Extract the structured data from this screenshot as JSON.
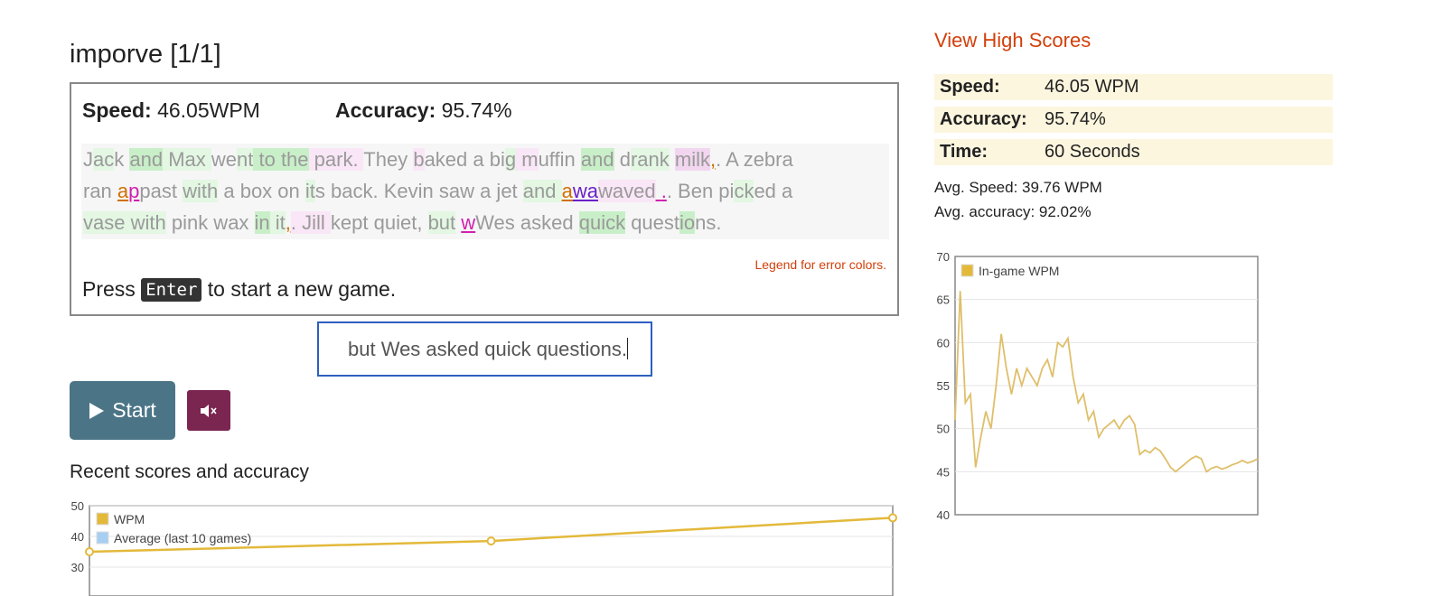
{
  "game": {
    "title": "imporve [1/1]",
    "speed_label": "Speed:",
    "speed_value": "46.05WPM",
    "accuracy_label": "Accuracy:",
    "accuracy_value": "95.74%",
    "legend_link": "Legend for error colors.",
    "press_prefix": "Press",
    "press_key": "Enter",
    "press_suffix": "to start a new game."
  },
  "passage": {
    "line1": [
      {
        "t": "J",
        "c": ""
      },
      {
        "t": "ac",
        "c": "g1"
      },
      {
        "t": "k ",
        "c": ""
      },
      {
        "t": "and",
        "c": "g2"
      },
      {
        "t": " Max ",
        "c": "g1"
      },
      {
        "t": "we",
        "c": ""
      },
      {
        "t": "nt",
        "c": "g1"
      },
      {
        "t": " to the",
        "c": "g2"
      },
      {
        "t": " park. ",
        "c": "p1"
      },
      {
        "t": "They ",
        "c": ""
      },
      {
        "t": "b",
        "c": "p1"
      },
      {
        "t": "aked a bi",
        "c": ""
      },
      {
        "t": "g",
        "c": "g1"
      },
      {
        "t": " m",
        "c": "p1"
      },
      {
        "t": "uffin ",
        "c": ""
      },
      {
        "t": "and",
        "c": "g2"
      },
      {
        "t": " d",
        "c": ""
      },
      {
        "t": "rank",
        "c": "g1"
      },
      {
        "t": " ",
        "c": ""
      },
      {
        "t": "milk",
        "c": "p2"
      },
      {
        "t": ",",
        "c": "err-o"
      },
      {
        "t": ". A zebra",
        "c": ""
      }
    ],
    "line2": [
      {
        "t": "ran ",
        "c": ""
      },
      {
        "t": "a",
        "c": "err-o"
      },
      {
        "t": "p",
        "c": "err-m"
      },
      {
        "t": "past ",
        "c": ""
      },
      {
        "t": "with",
        "c": "g1"
      },
      {
        "t": " a box on ",
        "c": ""
      },
      {
        "t": "it",
        "c": "g1"
      },
      {
        "t": "s back. Kevin saw a jet ",
        "c": ""
      },
      {
        "t": "and ",
        "c": "g1"
      },
      {
        "t": "a",
        "c": "err-o"
      },
      {
        "t": "wa",
        "c": "err-p"
      },
      {
        "t": "waved",
        "c": "p1"
      },
      {
        "t": " ",
        "c": "err-m"
      },
      {
        "t": ".",
        "c": "err-m"
      },
      {
        "t": ". Ben pi",
        "c": ""
      },
      {
        "t": "ck",
        "c": "g1"
      },
      {
        "t": "ed a",
        "c": ""
      }
    ],
    "line3": [
      {
        "t": "vase ",
        "c": "g1"
      },
      {
        "t": "with",
        "c": "g1"
      },
      {
        "t": " pink wax ",
        "c": ""
      },
      {
        "t": "in",
        "c": "g2"
      },
      {
        "t": " it",
        "c": "g1"
      },
      {
        "t": ",",
        "c": "err-o"
      },
      {
        "t": ". Jill ",
        "c": "p1"
      },
      {
        "t": "kept quiet, ",
        "c": ""
      },
      {
        "t": "but",
        "c": "g1"
      },
      {
        "t": " ",
        "c": ""
      },
      {
        "t": "w",
        "c": "err-m"
      },
      {
        "t": "Wes asked ",
        "c": ""
      },
      {
        "t": "quick",
        "c": "g2"
      },
      {
        "t": " quest",
        "c": ""
      },
      {
        "t": "io",
        "c": "g2"
      },
      {
        "t": "ns.",
        "c": ""
      }
    ]
  },
  "input": {
    "value": "but Wes asked quick questions."
  },
  "controls": {
    "start_label": "Start",
    "play_icon": "play-icon",
    "mute_icon": "speaker-mute-icon"
  },
  "recent": {
    "title": "Recent scores and accuracy"
  },
  "sidebar": {
    "high_scores_link": "View High Scores",
    "rows": [
      {
        "label": "Speed:",
        "value": "46.05 WPM"
      },
      {
        "label": "Accuracy:",
        "value": "95.74%"
      },
      {
        "label": "Time:",
        "value": "60 Seconds"
      }
    ],
    "avg_speed": "Avg. Speed: 39.76 WPM",
    "avg_accuracy": "Avg. accuracy: 92.02%"
  },
  "colors": {
    "accent": "#d2400c",
    "start_button": "#4b7587",
    "mute_button": "#7a2650",
    "wpm_line": "#e3b93a",
    "ingame_line": "#dfbf6a",
    "average_swatch": "#a6cff2"
  },
  "chart_data": [
    {
      "type": "line",
      "title": "",
      "legend": [
        "WPM",
        "Average (last 10 games)"
      ],
      "x": [
        1,
        2,
        3
      ],
      "series": [
        {
          "name": "WPM",
          "values": [
            35,
            38.5,
            46.05
          ]
        }
      ],
      "ylim": [
        20,
        50
      ],
      "yticks": [
        30,
        40,
        50
      ],
      "grid": true,
      "legend_position": "top-left"
    },
    {
      "type": "line",
      "title": "",
      "legend": [
        "In-game WPM"
      ],
      "series": [
        {
          "name": "In-game WPM",
          "values": [
            51,
            66,
            53,
            54,
            45.5,
            49,
            52,
            50,
            55,
            61,
            57,
            54,
            57,
            55,
            57,
            56,
            55,
            57,
            58,
            56,
            60,
            59.5,
            60.5,
            56,
            53,
            54,
            51,
            52,
            49,
            50,
            50.5,
            51,
            50,
            51,
            51.5,
            50.5,
            47,
            47.5,
            47.2,
            47.8,
            47.4,
            46.5,
            45.5,
            45,
            45.5,
            46,
            46.5,
            46.8,
            46.5,
            45,
            45.4,
            45.6,
            45.3,
            45.5,
            45.8,
            46,
            46.3,
            46,
            46.2,
            46.5
          ]
        }
      ],
      "ylim": [
        40,
        70
      ],
      "yticks": [
        40,
        45,
        50,
        55,
        60,
        65,
        70
      ],
      "grid": true,
      "legend_position": "top-left"
    }
  ]
}
